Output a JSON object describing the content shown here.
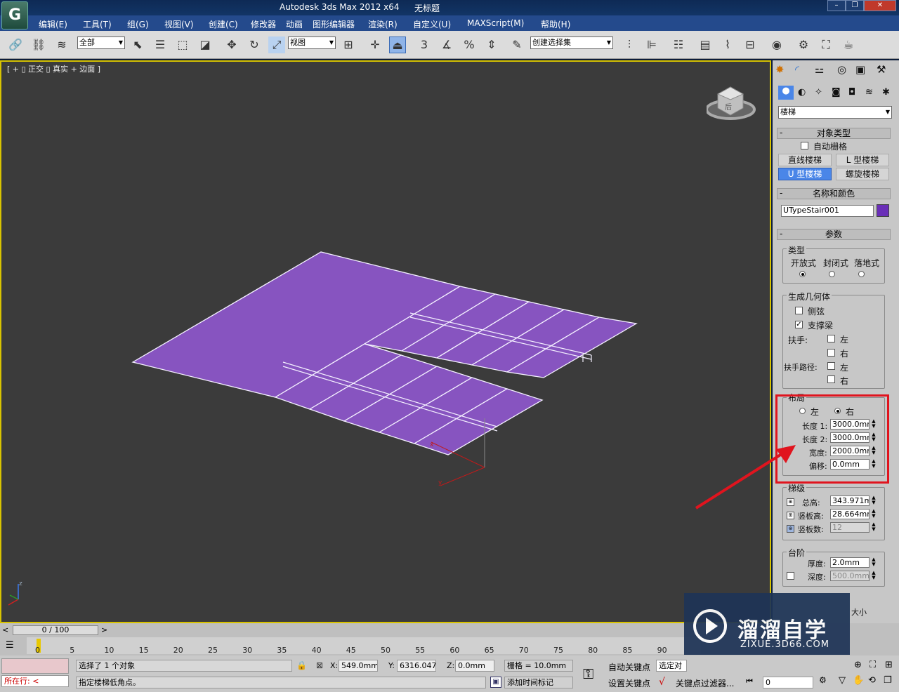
{
  "window": {
    "app_title": "Autodesk 3ds Max  2012 x64",
    "doc_title": "无标题",
    "logo": "G"
  },
  "menu": [
    "编辑(E)",
    "工具(T)",
    "组(G)",
    "视图(V)",
    "创建(C)",
    "修改器",
    "动画",
    "图形编辑器",
    "渲染(R)",
    "自定义(U)",
    "MAXScript(M)",
    "帮助(H)"
  ],
  "toolbar": {
    "filter_select": "全部",
    "ref_coord_select": "视图",
    "snap_label": "3",
    "named_selection": "创建选择集"
  },
  "viewport": {
    "label": "[ + ▯ 正交 ▯ 真实 + 边面 ]",
    "viewcube_label": "后",
    "axis_z": "z",
    "axis_x": "x",
    "axis_y": "y"
  },
  "command_panel": {
    "category_select": "楼梯",
    "object_type": {
      "title": "对象类型",
      "autogrid_label": "自动栅格",
      "buttons": [
        "直线楼梯",
        "L 型楼梯",
        "U 型楼梯",
        "螺旋楼梯"
      ],
      "active_button": "U 型楼梯"
    },
    "name_color": {
      "title": "名称和颜色",
      "name_value": "UTypeStair001",
      "color": "#6a2fb8"
    },
    "params": {
      "title": "参数",
      "type_group": "类型",
      "type_options": [
        "开放式",
        "封闭式",
        "落地式"
      ],
      "type_selected": "开放式",
      "geometry_group": "生成几何体",
      "stringers_label": "侧弦",
      "stringers_checked": false,
      "carriage_label": "支撑梁",
      "carriage_checked": true,
      "handrail_label": "扶手:",
      "handrail_path_label": "扶手路径:",
      "left_label": "左",
      "right_label": "右",
      "layout_group": "布局",
      "layout_left": "左",
      "layout_right": "右",
      "length1_label": "长度 1:",
      "length1_value": "3000.0mm",
      "length2_label": "长度 2:",
      "length2_value": "3000.0mm",
      "width_label": "宽度:",
      "width_value": "2000.0mm",
      "offset_label": "偏移:",
      "offset_value": "0.0mm",
      "rise_group": "梯级",
      "overall_label": "总高:",
      "overall_value": "343.971m",
      "riser_ht_label": "竖板高:",
      "riser_ht_value": "28.664mm",
      "riser_ct_label": "竖板数:",
      "riser_ct_value": "12",
      "steps_group": "台阶",
      "thickness_label": "厚度:",
      "thickness_value": "2.0mm",
      "depth_label": "深度:",
      "depth_value": "500.0mm",
      "size_partial": "大小"
    }
  },
  "timeline": {
    "frame": "0 / 100",
    "ticks": [
      "0",
      "5",
      "10",
      "15",
      "20",
      "25",
      "30",
      "35",
      "40",
      "45",
      "50",
      "55",
      "60",
      "65",
      "70",
      "75",
      "80",
      "85",
      "90"
    ]
  },
  "status": {
    "selected": "选择了 1 个对象",
    "prompt": "指定楼梯低角点。",
    "row_label": "所在行:",
    "x_label": "X:",
    "x_value": "549.0mm",
    "y_label": "Y:",
    "y_value": "6316.047m",
    "z_label": "Z:",
    "z_value": "0.0mm",
    "grid": "栅格 = 10.0mm",
    "add_time_tag": "添加时间标记",
    "auto_key": "自动关键点",
    "set_key": "设置关键点",
    "selected_obj": "选定对",
    "key_filters": "关键点过滤器...",
    "frame_value": "0"
  },
  "watermark": {
    "name": "溜溜自学",
    "url": "ZIXUE.3D66.COM"
  }
}
